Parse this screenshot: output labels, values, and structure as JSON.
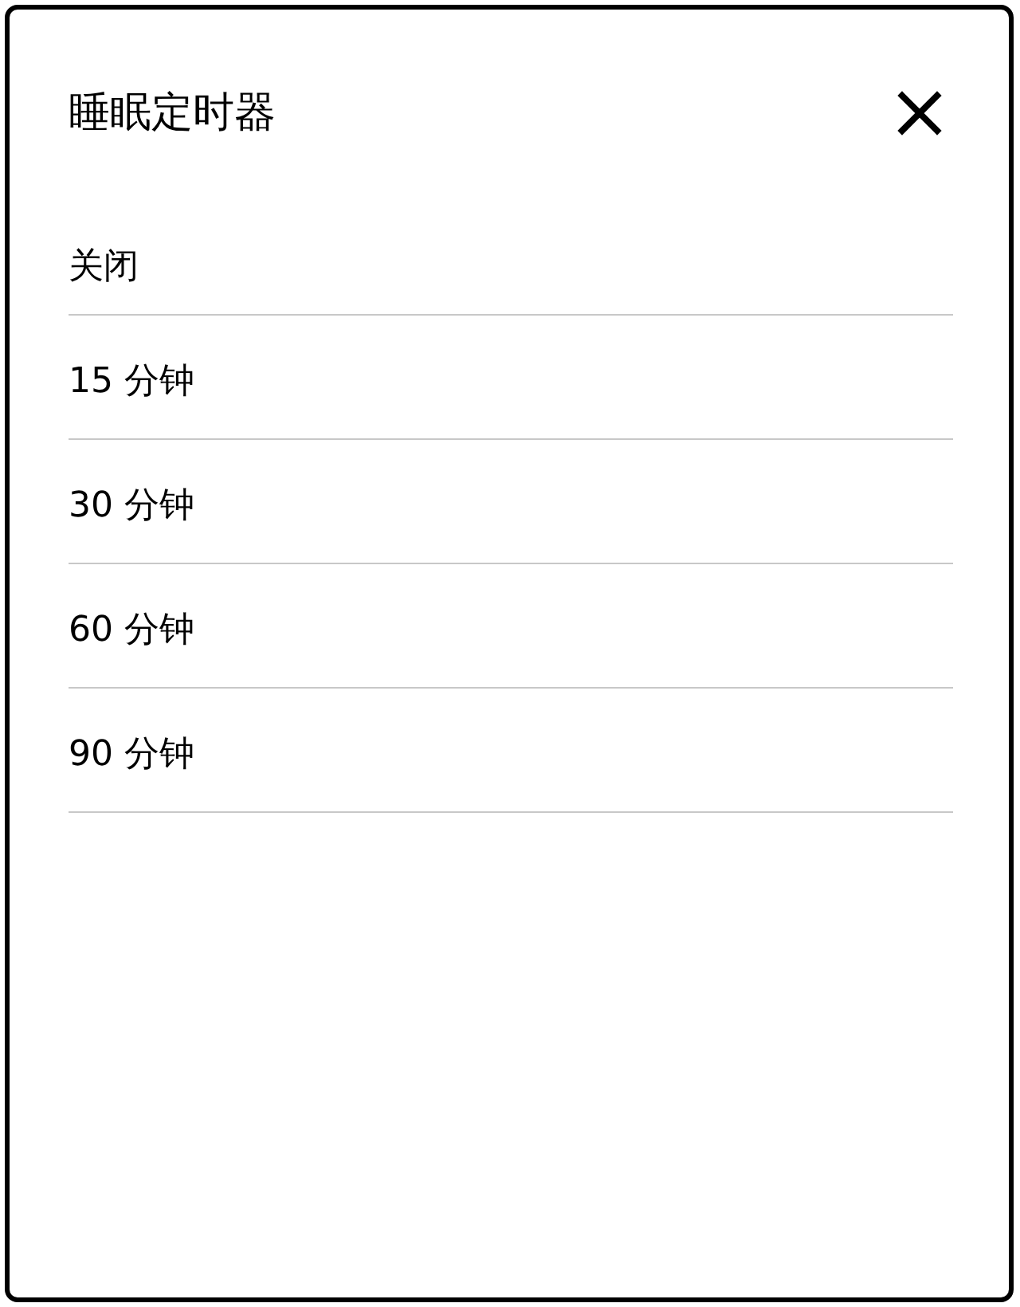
{
  "dialog": {
    "title": "睡眠定时器",
    "options": [
      {
        "label": "关闭"
      },
      {
        "label": "15 分钟"
      },
      {
        "label": "30 分钟"
      },
      {
        "label": "60 分钟"
      },
      {
        "label": "90 分钟"
      }
    ]
  }
}
